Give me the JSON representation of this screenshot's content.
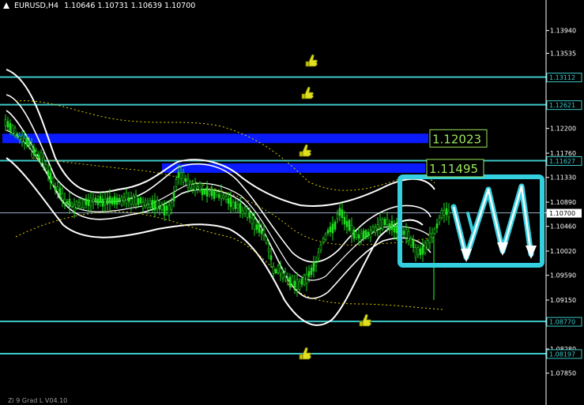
{
  "header": {
    "symbol": "EURUSD,H4",
    "ohlc": "1.10646 1.10731 1.10639 1.10700"
  },
  "footer_text": "Zi 9 Grad L V04.10",
  "price_scale": {
    "min_price": 1.07649,
    "max_price": 1.1416,
    "ticks": [
      "1.13940",
      "1.13535",
      "1.13112",
      "1.12621",
      "1.12200",
      "1.11760",
      "1.11627",
      "1.11330",
      "1.10890",
      "1.10700",
      "1.10460",
      "1.10020",
      "1.09590",
      "1.09150",
      "1.08770",
      "1.08280",
      "1.08197",
      "1.07850"
    ]
  },
  "levels": [
    {
      "price": 1.13112,
      "label": "1.13112",
      "color": "#3cc8c8",
      "end_fraction": 1.0
    },
    {
      "price": 1.12621,
      "label": "1.12621",
      "color": "#3cc8c8",
      "end_fraction": 1.0
    },
    {
      "price": 1.11627,
      "label": "1.11627",
      "color": "#3cc8c8",
      "end_fraction": 1.0
    },
    {
      "price": 1.0877,
      "label": "1.08770",
      "color": "#3cc8c8",
      "end_fraction": 1.0
    },
    {
      "price": 1.08197,
      "label": "1.08197",
      "color": "#3cc8c8",
      "end_fraction": 1.0
    }
  ],
  "current_price": {
    "price": 1.107,
    "label": "1.10700",
    "color": "#9bb4c8"
  },
  "zones": [
    {
      "price": 1.12023,
      "label": "1.12023",
      "color": "#0a1bff",
      "label_color": "#9be85a"
    },
    {
      "price": 1.11495,
      "label": "1.11495",
      "color": "#0a1bff",
      "label_color": "#9be85a"
    }
  ],
  "thumb_icon": "thumbs-up-icon",
  "arrows_icon": "zigzag-down-arrows-icon",
  "colors": {
    "background": "#000000",
    "candles": "#1fdc1f",
    "bands": "#ffffff",
    "dotted_outer": "#e0d000",
    "callout_border": "#35d0e0"
  }
}
